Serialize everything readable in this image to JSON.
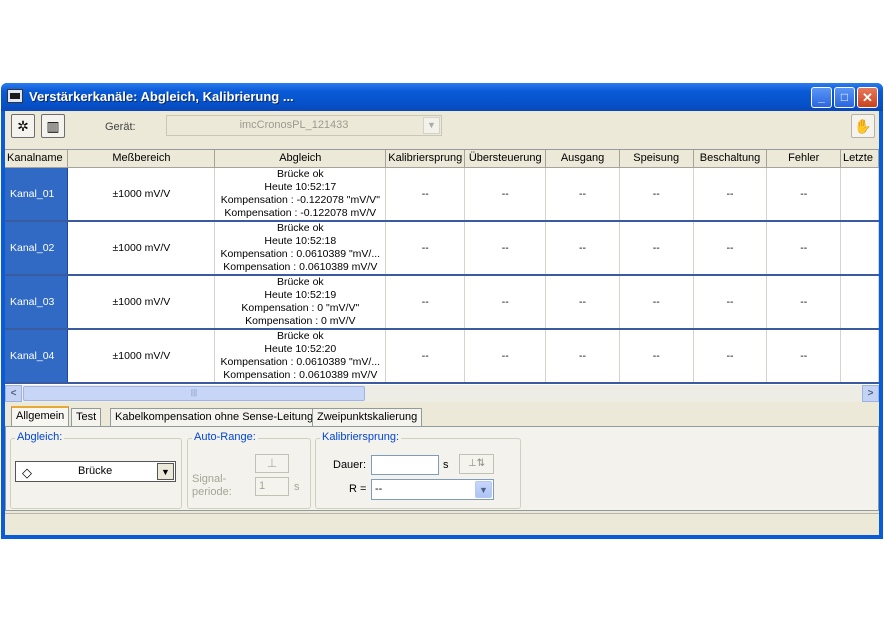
{
  "window": {
    "title": "Verstärkerkanäle: Abgleich, Kalibrierung ..."
  },
  "toolbar": {
    "device_label": "Gerät:",
    "device_value": "imcCronosPL_121433"
  },
  "grid": {
    "columns": [
      "Kanalname",
      "Meßbereich",
      "Abgleich",
      "Kalibriersprung",
      "Übersteuerung",
      "Ausgang",
      "Speisung",
      "Beschaltung",
      "Fehler",
      "Letzte"
    ],
    "rows": [
      {
        "name": "Kanal_01",
        "range": "±1000 mV/V",
        "abgleich": [
          "Brücke ok",
          "Heute  10:52:17",
          "Kompensation : -0.122078 \"mV/V\"",
          "Kompensation : -0.122078 mV/V"
        ],
        "rest": [
          "--",
          "--",
          "--",
          "--",
          "--",
          "--"
        ]
      },
      {
        "name": "Kanal_02",
        "range": "±1000 mV/V",
        "abgleich": [
          "Brücke ok",
          "Heute  10:52:18",
          "Kompensation : 0.0610389 \"mV/...",
          "Kompensation : 0.0610389 mV/V"
        ],
        "rest": [
          "--",
          "--",
          "--",
          "--",
          "--",
          "--"
        ]
      },
      {
        "name": "Kanal_03",
        "range": "±1000 mV/V",
        "abgleich": [
          "Brücke ok",
          "Heute  10:52:19",
          "Kompensation : 0 \"mV/V\"",
          "Kompensation : 0 mV/V"
        ],
        "rest": [
          "--",
          "--",
          "--",
          "--",
          "--",
          "--"
        ]
      },
      {
        "name": "Kanal_04",
        "range": "±1000 mV/V",
        "abgleich": [
          "Brücke ok",
          "Heute  10:52:20",
          "Kompensation : 0.0610389 \"mV/...",
          "Kompensation : 0.0610389 mV/V"
        ],
        "rest": [
          "--",
          "--",
          "--",
          "--",
          "--",
          "--"
        ]
      }
    ]
  },
  "tabs": [
    "Allgemein",
    "Test",
    "Kabelkompensation ohne Sense-Leitung",
    "Zweipunktskalierung"
  ],
  "active_tab": "Allgemein",
  "panel": {
    "abgleich": {
      "title": "Abgleich:",
      "button_label": "Brücke"
    },
    "auto_range": {
      "title": "Auto-Range:",
      "signal_label_1": "Signal-",
      "signal_label_2": "periode:",
      "value": "1",
      "unit": "s"
    },
    "kalibriersprung": {
      "title": "Kalibriersprung:",
      "dauer_label": "Dauer:",
      "dauer_value": "",
      "dauer_unit": "s",
      "r_label": "R =",
      "r_value": "--"
    }
  },
  "icons": [
    "app-window-icon",
    "minimize-icon",
    "maximize-icon",
    "close-icon",
    "add-channel-icon",
    "channel-list-icon",
    "hand-icon",
    "bridge-icon",
    "range-icon",
    "pulse-icon"
  ],
  "colors": {
    "title_bar": "#0a5ad6",
    "selection": "#316ac5",
    "group_title": "#0046d5",
    "face": "#ece9d8"
  }
}
